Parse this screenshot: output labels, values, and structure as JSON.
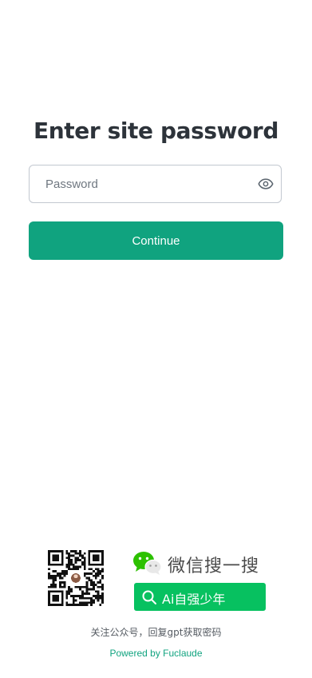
{
  "page": {
    "title": "Enter site password"
  },
  "password": {
    "placeholder": "Password",
    "value": ""
  },
  "continue_label": "Continue",
  "promo": {
    "wechat_search_label": "微信搜一搜",
    "search_keyword": "Ai自强少年",
    "follow_hint": "关注公众号，回复gpt获取密码"
  },
  "footer": {
    "powered_by": "Powered by Fuclaude"
  },
  "colors": {
    "accent": "#10a37f",
    "wechat_green": "#07c160",
    "title": "#2d333a",
    "border": "#c2c8d0"
  },
  "icons": {
    "visibility": "eye-icon",
    "wechat": "wechat-logo-icon",
    "search": "search-icon"
  }
}
